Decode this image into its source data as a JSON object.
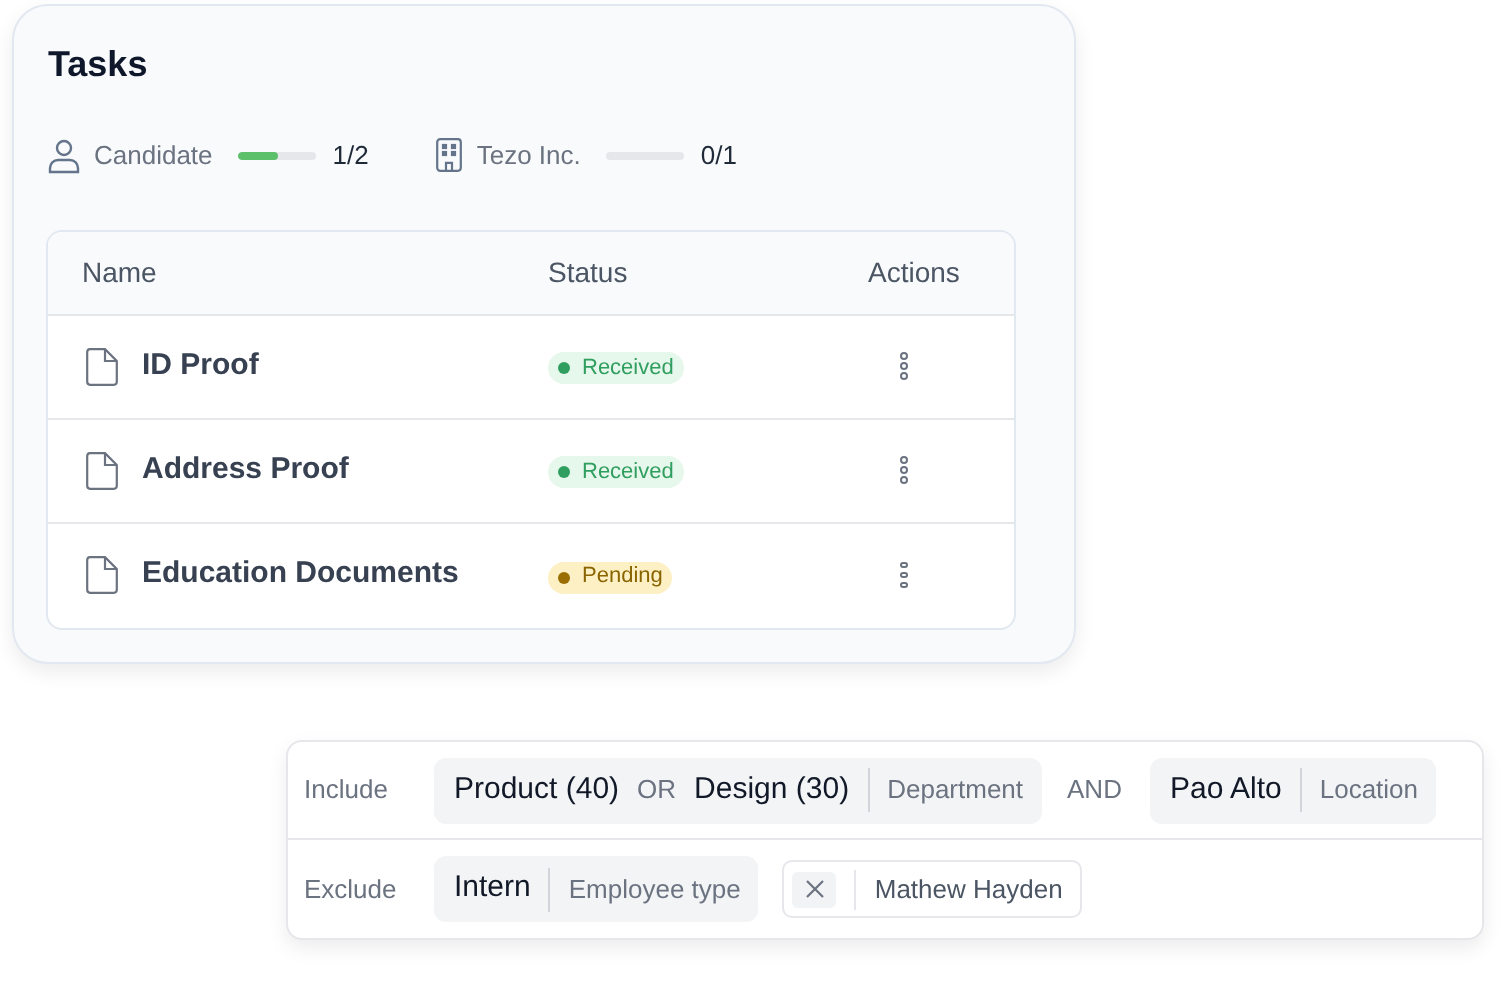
{
  "tasks": {
    "title": "Tasks",
    "progress": [
      {
        "kind": "person",
        "label": "Candidate",
        "level": 0.5,
        "reading": "1/2"
      },
      {
        "kind": "building",
        "label": "Tezo Inc.",
        "level": 0,
        "reading": "0/1"
      }
    ],
    "table": {
      "columns": [
        "Name",
        "Status",
        "Actions"
      ],
      "rows": [
        {
          "name": "ID Proof",
          "status": "Received",
          "kind": "success"
        },
        {
          "name": "Address Proof",
          "status": "Received",
          "kind": "success"
        },
        {
          "name": "Education Documents",
          "status": "Pending",
          "kind": "warning"
        }
      ]
    }
  },
  "filters": [
    {
      "label": "Include",
      "items": [
        {
          "kind": "chip",
          "parts": [
            {
              "kind": "value",
              "text": "Product (40)"
            },
            {
              "kind": "op",
              "text": "OR"
            },
            {
              "kind": "value",
              "text": "Design (30)"
            }
          ],
          "field": "Department"
        },
        {
          "kind": "connector",
          "text": "AND"
        },
        {
          "kind": "chip",
          "parts": [
            {
              "kind": "value",
              "text": "Pao Alto"
            }
          ],
          "field": "Location"
        }
      ]
    },
    {
      "label": "Exclude",
      "items": [
        {
          "kind": "chip",
          "parts": [
            {
              "kind": "value",
              "text": "Intern"
            }
          ],
          "field": "Employee type"
        },
        {
          "kind": "removable",
          "text": "Mathew Hayden"
        }
      ]
    }
  ]
}
